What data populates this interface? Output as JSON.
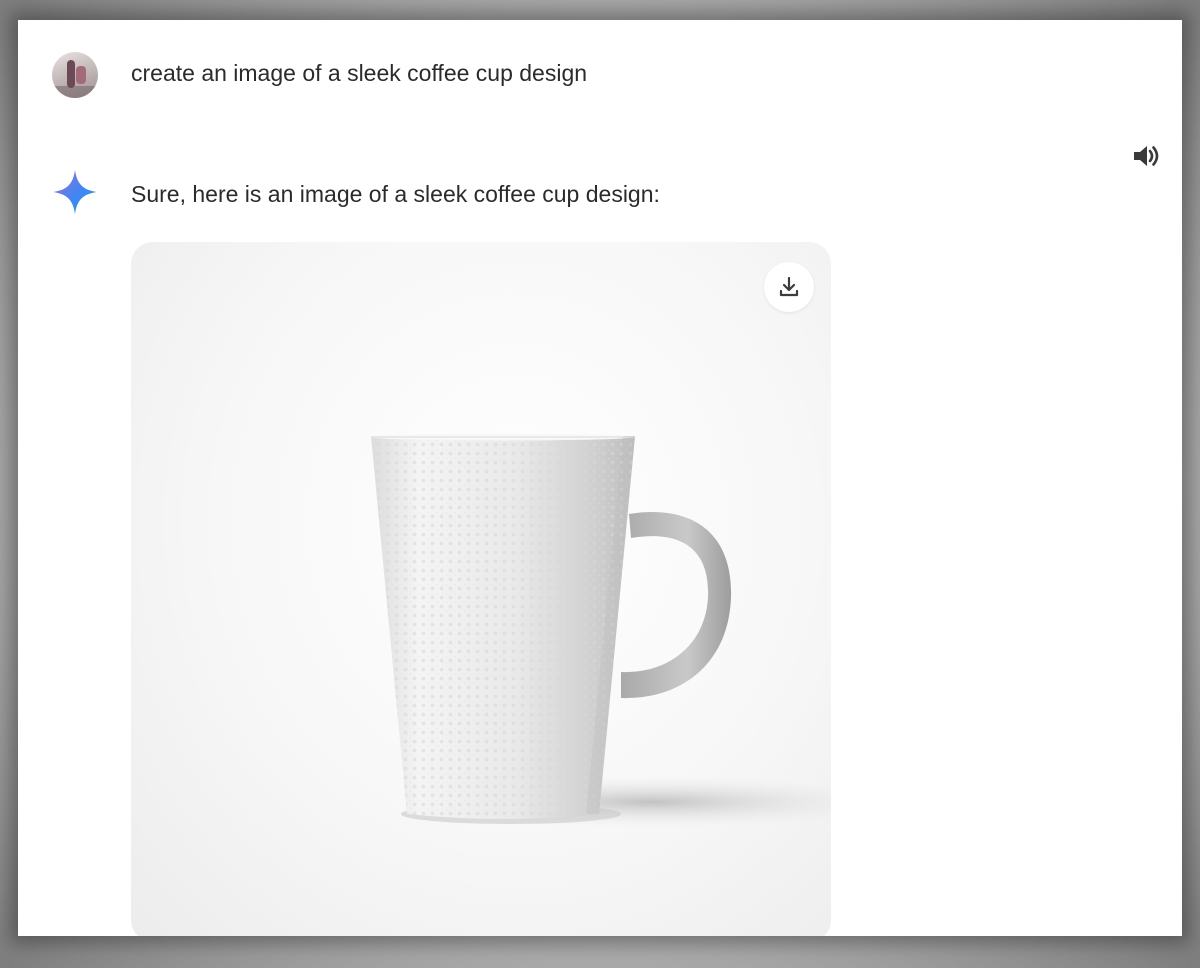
{
  "conversation": {
    "user_message": {
      "text": "create an image of a sleek coffee cup design",
      "avatar_icon": "user-avatar"
    },
    "assistant_message": {
      "text": "Sure, here is an image of a sleek coffee cup design:",
      "icon": "sparkle-icon",
      "icon_colors": [
        "#4285f4",
        "#9b72cb",
        "#d96570"
      ],
      "image": {
        "subject": "white textured coffee mug with handle",
        "download_icon": "download-icon"
      }
    },
    "read_aloud_icon": "speaker-icon"
  }
}
